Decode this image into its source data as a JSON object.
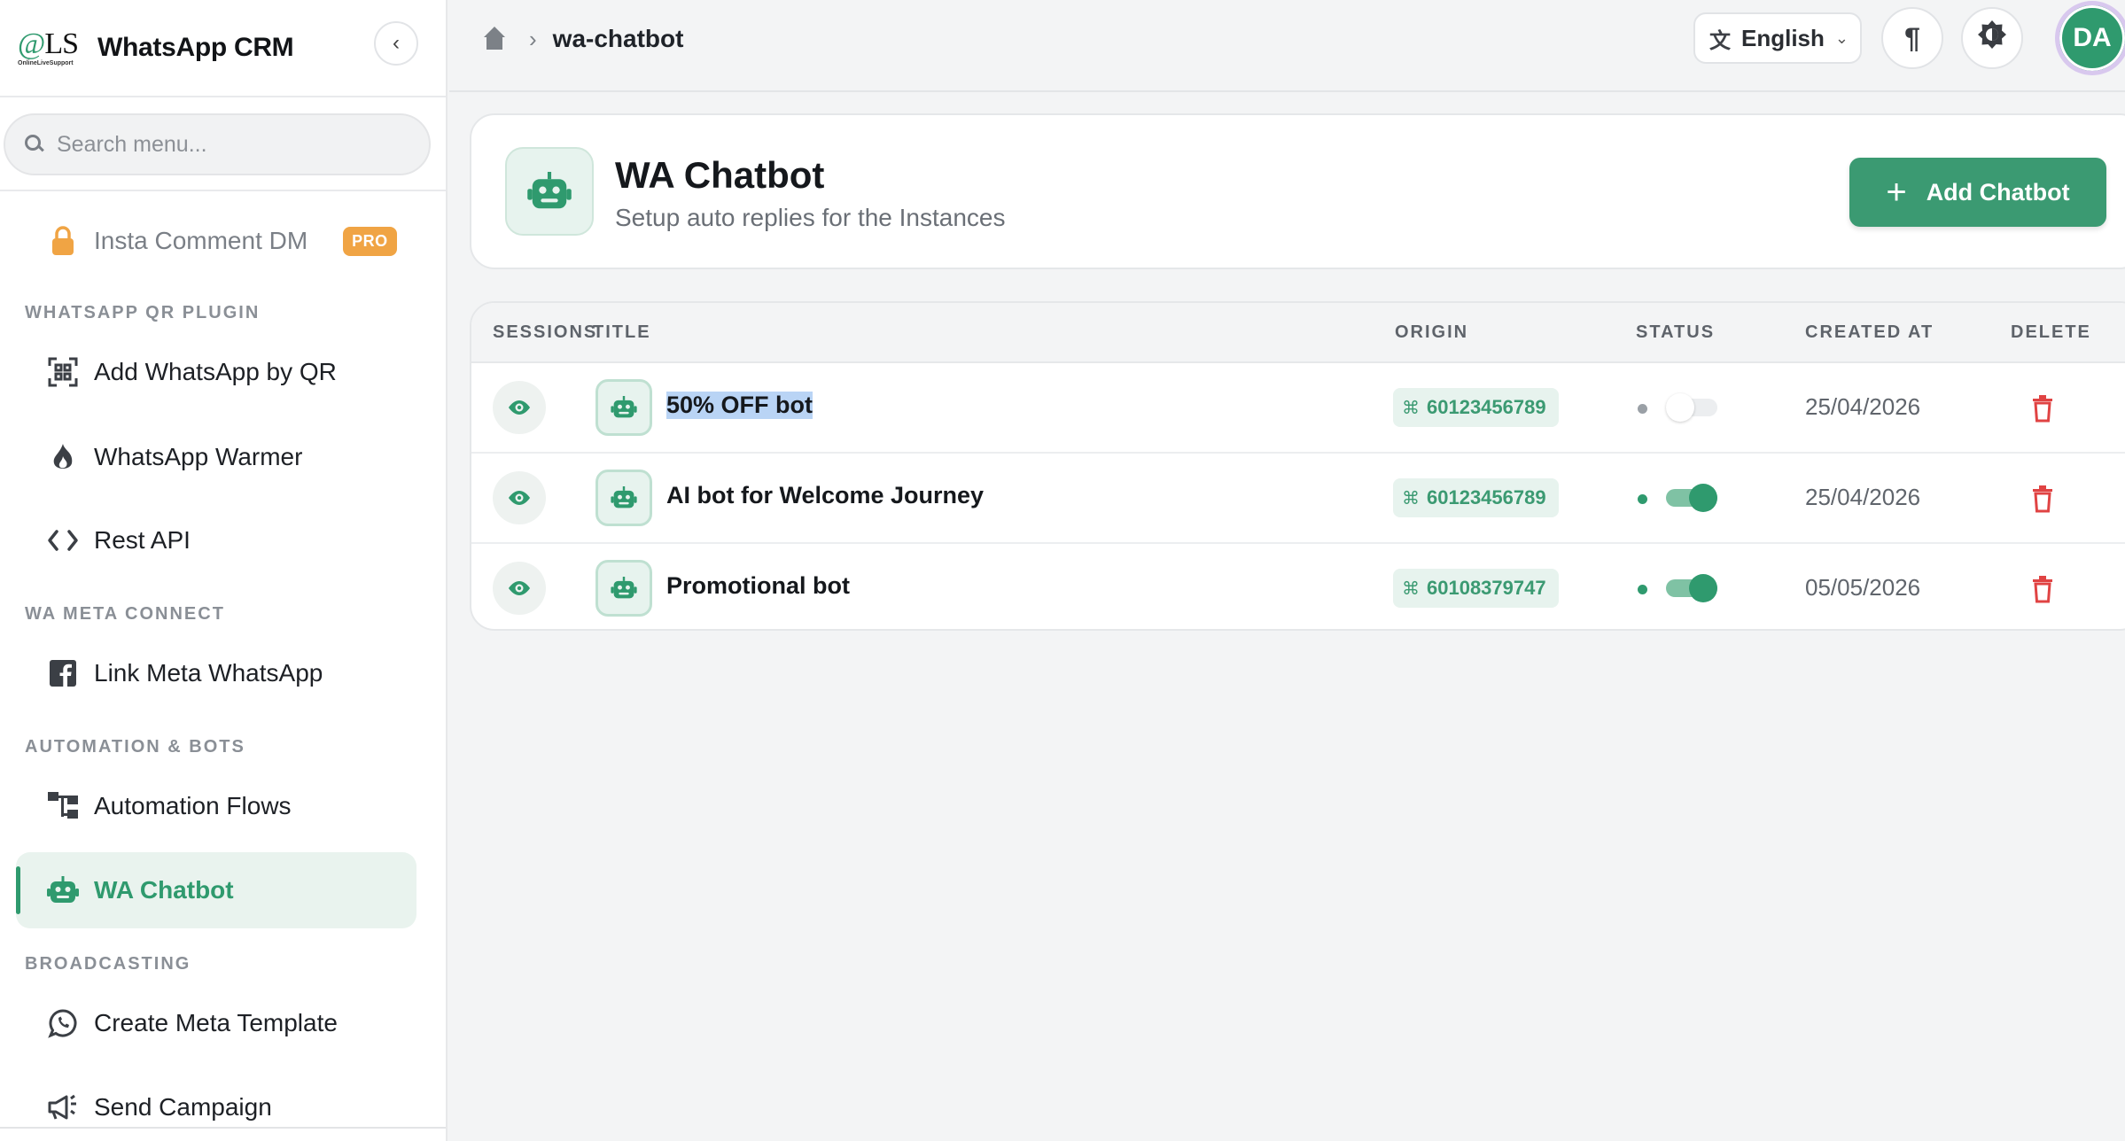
{
  "app": {
    "logo_text": "OLS",
    "logo_sub": "OnlineLiveSupport",
    "title": "WhatsApp CRM"
  },
  "sidebar": {
    "search_placeholder": "Search menu...",
    "items": [
      {
        "label": "Insta Comment DM",
        "badge": "PRO",
        "icon": "lock-icon"
      },
      {
        "section": "WHATSAPP QR PLUGIN"
      },
      {
        "label": "Add WhatsApp by QR",
        "icon": "qr-code-icon"
      },
      {
        "label": "WhatsApp Warmer",
        "icon": "fire-icon"
      },
      {
        "label": "Rest API",
        "icon": "code-icon"
      },
      {
        "section": "WA META CONNECT"
      },
      {
        "label": "Link Meta WhatsApp",
        "icon": "facebook-icon"
      },
      {
        "section": "AUTOMATION & BOTS"
      },
      {
        "label": "Automation Flows",
        "icon": "flow-icon"
      },
      {
        "label": "WA Chatbot",
        "icon": "robot-icon",
        "active": true
      },
      {
        "section": "BROADCASTING"
      },
      {
        "label": "Create Meta Template",
        "icon": "whatsapp-icon"
      },
      {
        "label": "Send Campaign",
        "icon": "megaphone-icon"
      }
    ]
  },
  "topbar": {
    "breadcrumb_current": "wa-chatbot",
    "language": "English",
    "avatar_initials": "DA"
  },
  "header": {
    "title": "WA Chatbot",
    "subtitle": "Setup auto replies for the Instances",
    "add_button": "Add Chatbot"
  },
  "table": {
    "columns": {
      "sessions": "SESSIONS",
      "title": "TITLE",
      "origin": "ORIGIN",
      "status": "STATUS",
      "created_at": "CREATED AT",
      "delete": "DELETE"
    },
    "rows": [
      {
        "title": "50% OFF bot",
        "origin": "60123456789",
        "status_on": false,
        "created_at": "25/04/2026"
      },
      {
        "title": "AI bot for Welcome Journey",
        "origin": "60123456789",
        "status_on": true,
        "created_at": "25/04/2026"
      },
      {
        "title": "Promotional bot",
        "origin": "60108379747",
        "status_on": true,
        "created_at": "05/05/2026"
      }
    ]
  },
  "colors": {
    "accent": "#2f9a6e",
    "pro_badge": "#f0a444",
    "delete": "#e04343"
  }
}
